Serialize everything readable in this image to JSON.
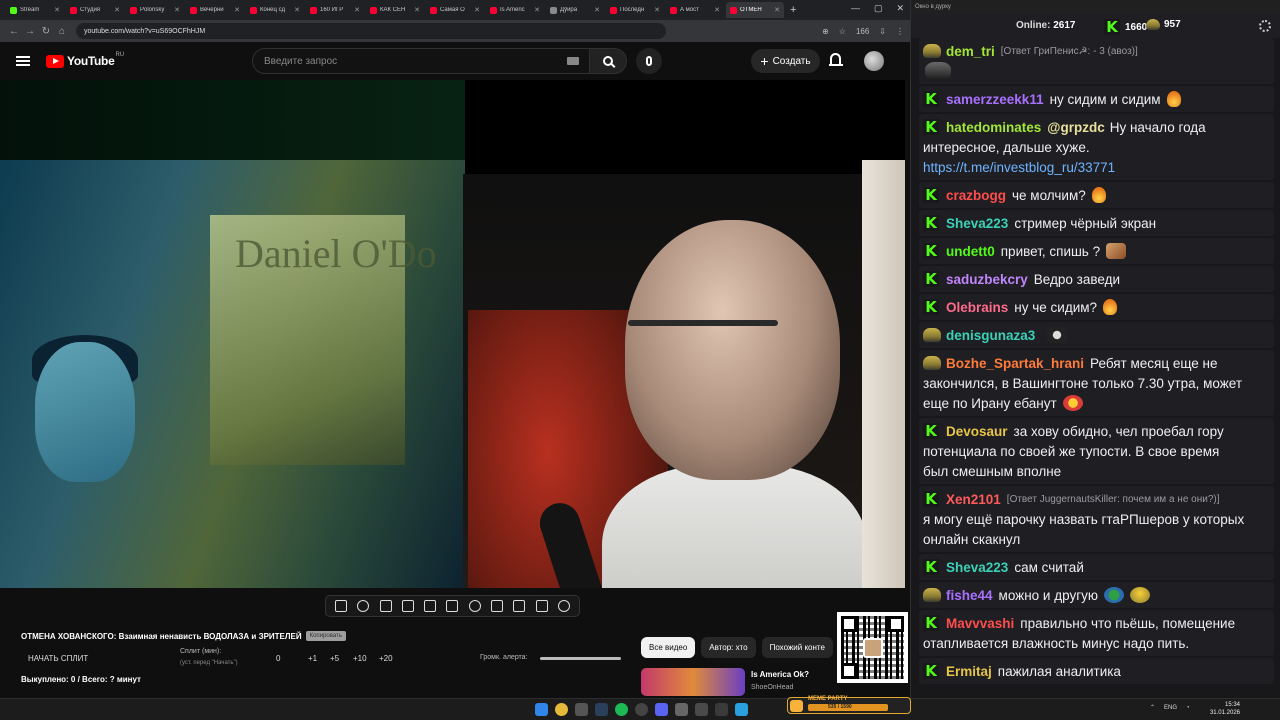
{
  "browser": {
    "tabs": [
      {
        "label": "Stream",
        "color": "#53fc18"
      },
      {
        "label": "Студия",
        "color": "#ff0033"
      },
      {
        "label": "Polonsky",
        "color": "#ff0033"
      },
      {
        "label": "Вечерни",
        "color": "#ff0033"
      },
      {
        "label": "Конец сд",
        "color": "#ff0033"
      },
      {
        "label": "160 ИГР",
        "color": "#ff0033"
      },
      {
        "label": "КАК СЕН",
        "color": "#ff0033"
      },
      {
        "label": "Самая О",
        "color": "#ff0033"
      },
      {
        "label": "Is Americ",
        "color": "#ff0033"
      },
      {
        "label": "Дўира",
        "color": "#8a8a8a"
      },
      {
        "label": "Последн",
        "color": "#ff0033"
      },
      {
        "label": "А мост",
        "color": "#ff0033"
      },
      {
        "label": "ОТМЕН",
        "color": "#ff0033",
        "active": true
      }
    ],
    "url": "youtube.com/watch?v=uS69OCFhHJM",
    "notif_count": "166"
  },
  "youtube": {
    "logo_text": "YouTube",
    "region": "RU",
    "search_placeholder": "Введите запрос",
    "create_label": "Создать",
    "video_title": "ОТМЕНА ХОВАНСКОГО: Взаимная ненависть ВОДОЛАЗА и ЗРИТЕЛЕЙ",
    "tag_chip": "Копировать",
    "split": {
      "start_label": "НАЧАТЬ СПЛИТ",
      "minutes_label": "Сплит (мин):",
      "minutes_hint": "(уст. перед \"Начать\")",
      "values": [
        "0",
        "+1",
        "+5",
        "+10",
        "+20"
      ]
    },
    "alert_label": "Громк. алерта:",
    "bought_line": "Выкуплено: 0 / Всего: ? минут",
    "chips": [
      "Все видео",
      "Автор: хто",
      "Похожий конте"
    ],
    "rec": {
      "title": "Is America Ok?",
      "channel": "ShoeOnHead"
    },
    "overlay_emoji": "👍",
    "poster_text": "Daniel O'Do"
  },
  "chat": {
    "window_title": "Окно в дурку",
    "online_label": "Online:",
    "online_value": "2617",
    "count_k": "1660",
    "count_p": "957",
    "messages": [
      {
        "badge": "p",
        "user": "dem_tri",
        "color": "#a3e635",
        "reply": "[Ответ ГриПенис☭: - 3 (авоз)]",
        "lines": [
          ""
        ],
        "emote_line2": "pepesm"
      },
      {
        "badge": "k",
        "user": "samerzzeekk11",
        "color": "#a970ff",
        "lines": [
          "ну сидим и сидим"
        ],
        "emote": "fire"
      },
      {
        "badge": "k",
        "user": "hatedominates",
        "color": "#a3e635",
        "mention": "@grpzdc",
        "lines": [
          "Ну начало года",
          "интересное, дальше хуже.",
          "https://t.me/investblog_ru/33771"
        ]
      },
      {
        "badge": "k",
        "user": "crazbogg",
        "color": "#ff4d4d",
        "lines": [
          "че молчим?"
        ],
        "emote": "fire"
      },
      {
        "badge": "k",
        "user": "Sheva223",
        "color": "#3ad1b7",
        "lines": [
          "стример чёрный экран"
        ]
      },
      {
        "badge": "k",
        "user": "undett0",
        "color": "#53fc18",
        "lines": [
          "привет, спишь ?"
        ],
        "emote": "face"
      },
      {
        "badge": "k",
        "user": "saduzbekcry",
        "color": "#c084fc",
        "lines": [
          "Ведро заведи"
        ]
      },
      {
        "badge": "k",
        "user": "Olebrains",
        "color": "#ff6b8a",
        "lines": [
          "ну че сидим?"
        ],
        "emote": "fire"
      },
      {
        "badge": "p",
        "user": "denisgunaza3",
        "color": "#3ad1b7",
        "lines": [
          ""
        ],
        "emote": "cat"
      },
      {
        "badge": "p",
        "user": "Bozhe_Spartak_hrani",
        "color": "#ff7b3a",
        "lines": [
          "Ребят месяц еще не",
          "закончился, в Вашингтоне только 7.30 утра, может",
          "еще по Ирану ебанут"
        ],
        "emote_last": "red"
      },
      {
        "badge": "k",
        "user": "Devosaur",
        "color": "#e8c547",
        "lines": [
          "за хову обидно, чел проебал гору",
          "потенциала по своей же тупости. В свое время",
          "был смешным вполне"
        ]
      },
      {
        "badge": "k",
        "user": "Xen2101",
        "color": "#ff5a5a",
        "reply": "[Ответ JuggernautsKiller: почем им а не они?)]",
        "lines": [
          "",
          "я могу ещё парочку назвать гтаРПшеров у которых",
          "онлайн скакнул"
        ]
      },
      {
        "badge": "k",
        "user": "Sheva223",
        "color": "#3ad1b7",
        "lines": [
          "сам считай"
        ]
      },
      {
        "badge": "p",
        "user": "fishe44",
        "color": "#a970ff",
        "lines": [
          "можно и другую"
        ],
        "emote": "globe",
        "emote2": "pepe"
      },
      {
        "badge": "k",
        "user": "Mavvvashi",
        "color": "#ff4d4d",
        "lines": [
          "правильно что пьёшь, помещение",
          "отапливается влажность минус надо пить."
        ]
      },
      {
        "badge": "k",
        "user": "Ermitaj",
        "color": "#e8c547",
        "lines": [
          "пажилая аналитика"
        ]
      }
    ]
  },
  "taskbar": {
    "meme_label": "MEME PARTY",
    "meme_value": "535 / 1590",
    "lang": "ENG",
    "time": "15:34",
    "date": "31.01.2026"
  }
}
